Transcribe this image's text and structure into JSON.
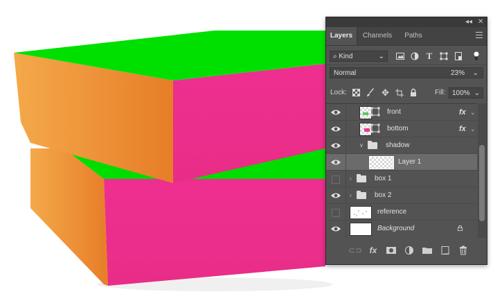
{
  "colors": {
    "box_top": "#00e000",
    "box_side": "#ef9a3a",
    "box_front": "#ec2e8e",
    "panel_bg": "#535353",
    "selected_row": "#6b6b6b"
  },
  "panel": {
    "tabs": [
      {
        "label": "Layers",
        "active": true
      },
      {
        "label": "Channels",
        "active": false
      },
      {
        "label": "Paths",
        "active": false
      }
    ],
    "filter": {
      "kind_label": "Kind",
      "icons": [
        "image-filter-icon",
        "adjustment-filter-icon",
        "type-filter-icon",
        "shape-filter-icon",
        "smart-object-filter-icon"
      ]
    },
    "blend_mode": "Normal",
    "opacity": "23%",
    "lock_label": "Lock:",
    "fill_label": "Fill:",
    "fill_value": "100%",
    "layers": [
      {
        "name": "front",
        "visible": true,
        "fx": true,
        "type": "layer"
      },
      {
        "name": "bottom",
        "visible": true,
        "fx": true,
        "type": "layer"
      },
      {
        "name": "shadow",
        "visible": true,
        "type": "group",
        "expanded": true
      },
      {
        "name": "Layer 1",
        "visible": true,
        "type": "layer",
        "selected": true
      },
      {
        "name": "box 1",
        "visible": false,
        "type": "group",
        "expanded": false
      },
      {
        "name": "box 2",
        "visible": true,
        "type": "group",
        "expanded": false
      },
      {
        "name": "reference",
        "visible": false,
        "type": "layer"
      },
      {
        "name": "Background",
        "visible": true,
        "type": "background",
        "locked": true
      }
    ],
    "bottom_icons": [
      "link-layers-icon",
      "fx-icon",
      "mask-icon",
      "adjustment-icon",
      "new-group-icon",
      "new-layer-icon",
      "trash-icon"
    ]
  },
  "fx_label": "fx"
}
